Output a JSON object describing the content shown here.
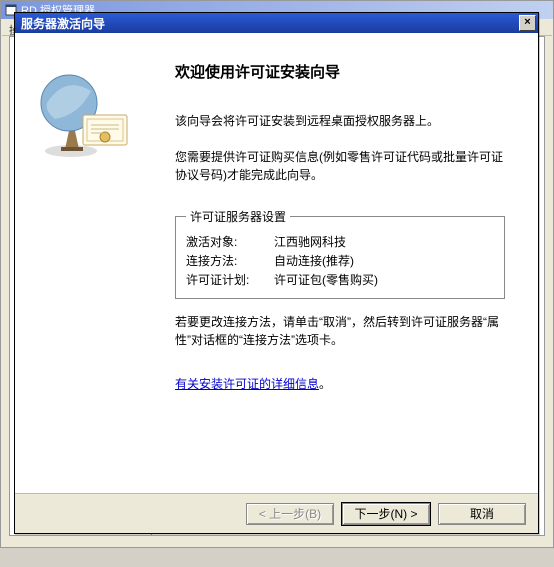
{
  "bg_window": {
    "title": "RD 授权管理器",
    "menu_stub": "操"
  },
  "dialog": {
    "title": "服务器激活向导",
    "heading": "欢迎使用许可证安装向导",
    "intro": "该向导会将许可证安装到远程桌面授权服务器上。",
    "need_info": "您需要提供许可证购买信息(例如零售许可证代码或批量许可证协议号码)才能完成此向导。",
    "group_title": "许可证服务器设置",
    "rows": [
      {
        "k": "激活对象:",
        "v": "江西驰网科技"
      },
      {
        "k": "连接方法:",
        "v": "自动连接(推荐)"
      },
      {
        "k": "许可证计划:",
        "v": "许可证包(零售购买)"
      }
    ],
    "change_note": "若要更改连接方法，请单击“取消”，然后转到许可证服务器“属性”对话框的“连接方法”选项卡。",
    "link_text": "有关安装许可证的详细信息",
    "link_suffix": "。",
    "buttons": {
      "back": "< 上一步(B)",
      "next": "下一步(N) >",
      "cancel": "取消"
    },
    "close_glyph": "×"
  }
}
